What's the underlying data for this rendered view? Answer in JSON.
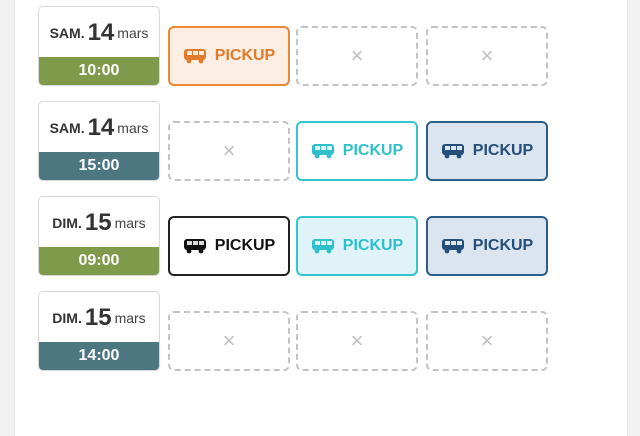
{
  "colors": {
    "time_green": "#7f9a4a",
    "time_teal": "#4d7780",
    "orange": "#e8883a",
    "cyan": "#35c5cf",
    "navy": "#2c5e8c",
    "dark": "#222222",
    "empty_dash": "#c4c4c4"
  },
  "icons": {
    "vehicle": "bus-icon",
    "empty": "close-icon"
  },
  "empty_symbol": "×",
  "schedule": [
    {
      "date": {
        "dow": "SAM.",
        "day": "14",
        "month": "mars"
      },
      "time": "10:00",
      "time_color": "time_green",
      "slots": [
        {
          "state": "pickup",
          "variant": "orange",
          "label": "PICKUP"
        },
        {
          "state": "empty"
        },
        {
          "state": "empty"
        }
      ]
    },
    {
      "date": {
        "dow": "SAM.",
        "day": "14",
        "month": "mars"
      },
      "time": "15:00",
      "time_color": "time_teal",
      "slots": [
        {
          "state": "empty"
        },
        {
          "state": "pickup",
          "variant": "cyan",
          "label": "PICKUP"
        },
        {
          "state": "pickup",
          "variant": "navy",
          "label": "PICKUP"
        }
      ]
    },
    {
      "date": {
        "dow": "DIM.",
        "day": "15",
        "month": "mars"
      },
      "time": "09:00",
      "time_color": "time_green",
      "slots": [
        {
          "state": "pickup",
          "variant": "dark",
          "label": "PICKUP"
        },
        {
          "state": "pickup",
          "variant": "cyanfill",
          "label": "PICKUP"
        },
        {
          "state": "pickup",
          "variant": "navy",
          "label": "PICKUP"
        }
      ]
    },
    {
      "date": {
        "dow": "DIM.",
        "day": "15",
        "month": "mars"
      },
      "time": "14:00",
      "time_color": "time_teal",
      "slots": [
        {
          "state": "empty"
        },
        {
          "state": "empty"
        },
        {
          "state": "empty"
        }
      ]
    }
  ]
}
